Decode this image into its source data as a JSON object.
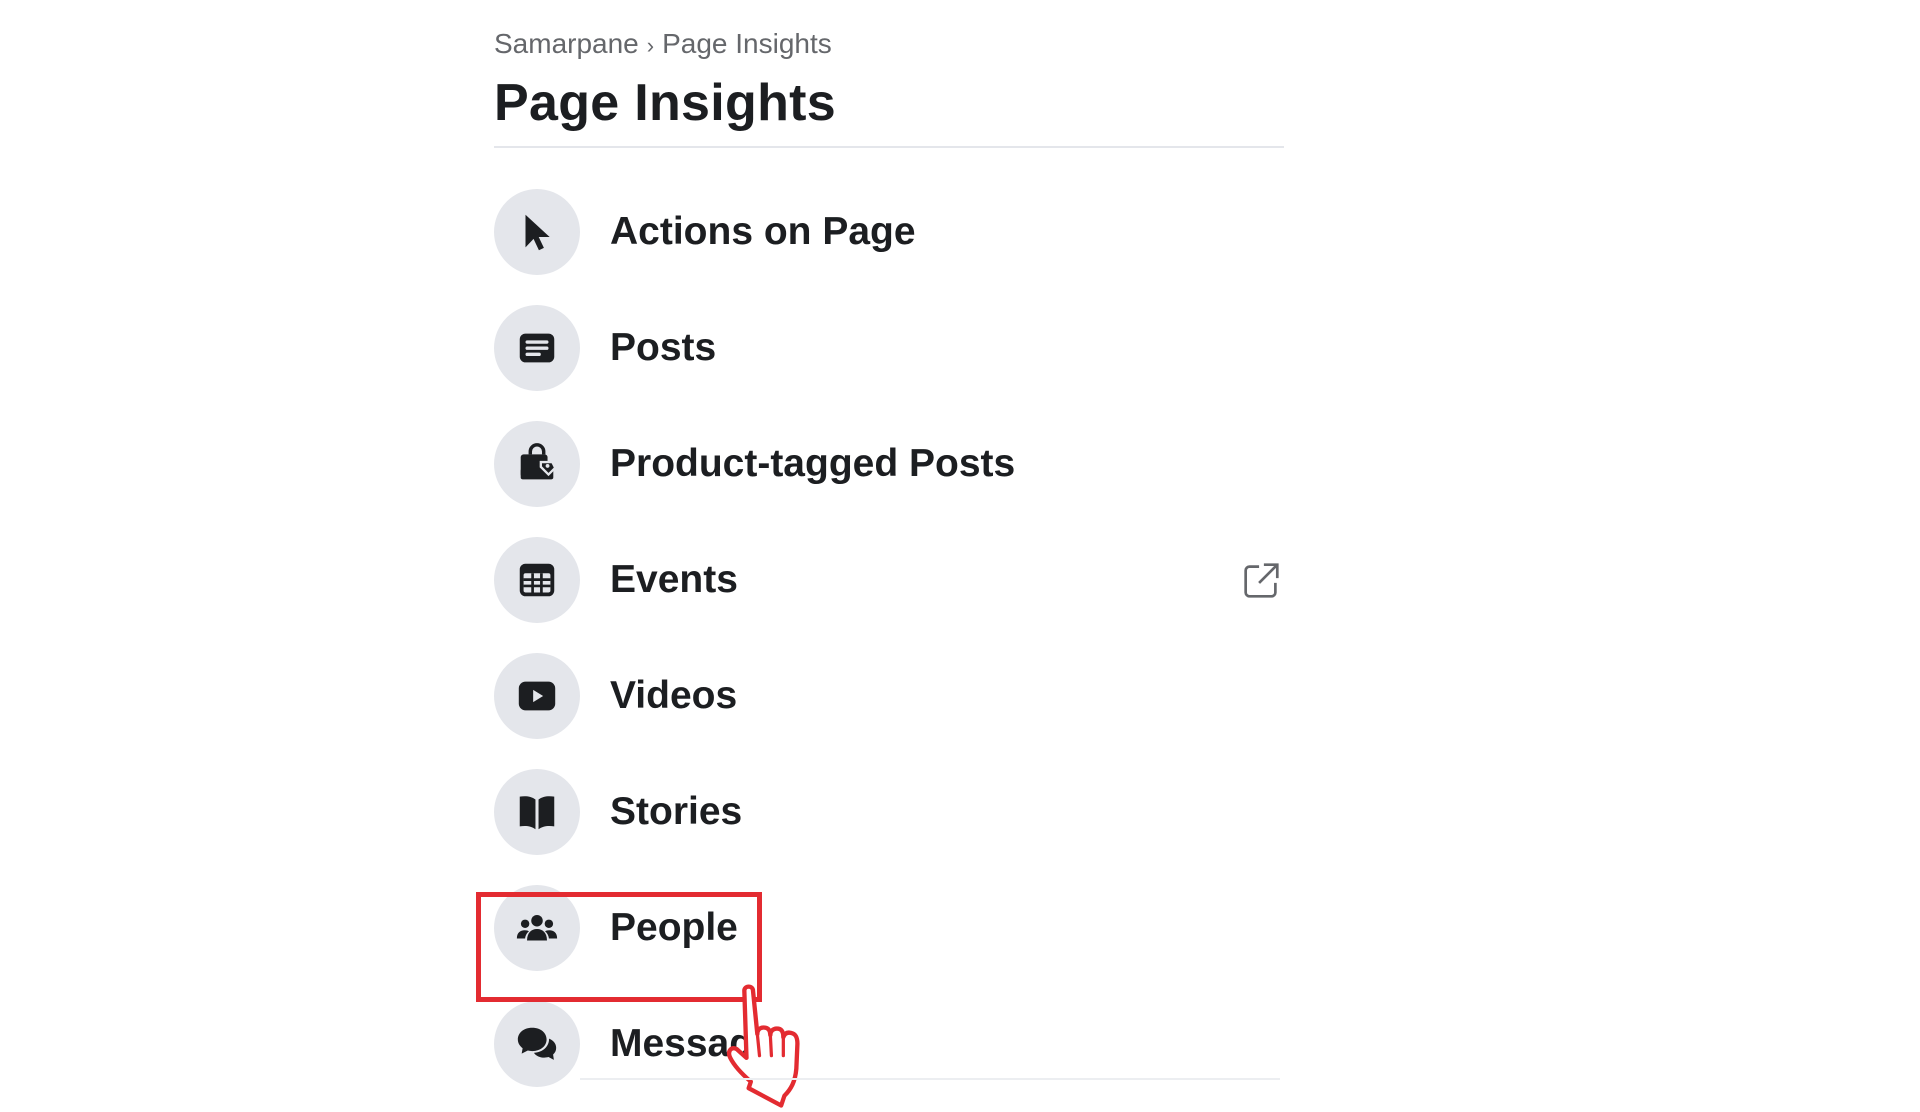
{
  "breadcrumb": {
    "parent": "Samarpane",
    "separator": "›",
    "current": "Page Insights"
  },
  "header": {
    "title": "Page Insights"
  },
  "menu": {
    "items": [
      {
        "label": "Actions on Page",
        "icon": "cursor-icon"
      },
      {
        "label": "Posts",
        "icon": "posts-icon"
      },
      {
        "label": "Product-tagged Posts",
        "icon": "shopping-bag-tag-icon"
      },
      {
        "label": "Events",
        "icon": "calendar-icon",
        "trailing_icon": "external-link-icon"
      },
      {
        "label": "Videos",
        "icon": "video-play-icon"
      },
      {
        "label": "Stories",
        "icon": "book-open-icon",
        "highlighted": true
      },
      {
        "label": "People",
        "icon": "people-group-icon"
      },
      {
        "label": "Messages",
        "icon": "messages-icon"
      }
    ]
  },
  "colors": {
    "highlight": "#e32b31",
    "icon_circle": "#e4e6eb",
    "text": "#1c1e21",
    "muted_text": "#65676b"
  }
}
